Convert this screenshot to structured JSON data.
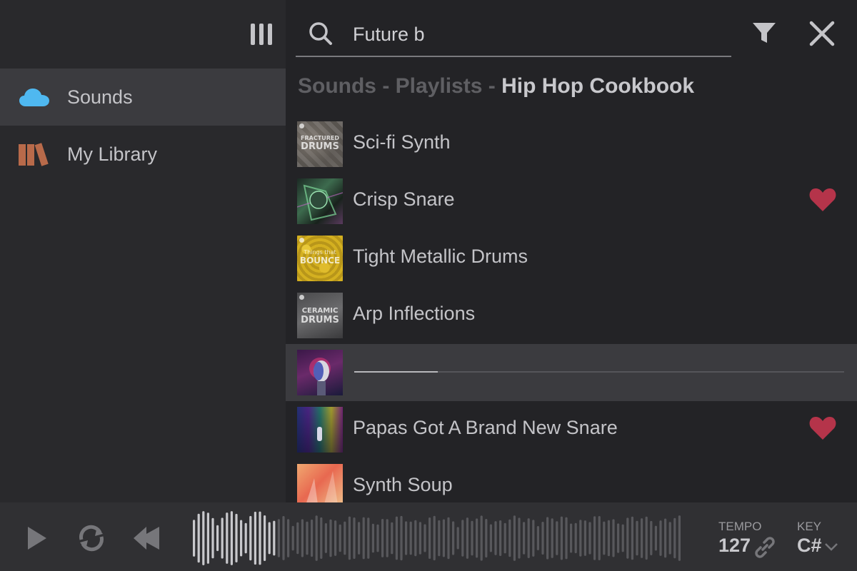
{
  "sidebar": {
    "items": [
      {
        "label": "Sounds",
        "icon": "cloud-icon",
        "active": true
      },
      {
        "label": "My Library",
        "icon": "books-icon",
        "active": false
      }
    ]
  },
  "search": {
    "value": "Future b",
    "placeholder": ""
  },
  "breadcrumb": {
    "part1": "Sounds",
    "sep1": " - ",
    "part2": "Playlists",
    "sep2": " - ",
    "current": "Hip Hop Cookbook"
  },
  "list": {
    "items": [
      {
        "title": "Sci-fi Synth",
        "thumb_line1": "FRACTURED",
        "thumb_line2": "DRUMS",
        "liked": false
      },
      {
        "title": "Crisp Snare",
        "liked": true
      },
      {
        "title": "Tight Metallic Drums",
        "thumb_line1": "Things that",
        "thumb_line2": "BOUNCE",
        "liked": false
      },
      {
        "title": "Arp Inflections",
        "thumb_line1": "CERAMIC",
        "thumb_line2": "DRUMS",
        "liked": false
      },
      {
        "title": "",
        "playing": true,
        "progress": 0.17,
        "liked": false
      },
      {
        "title": "Papas Got A Brand New Snare",
        "liked": true
      },
      {
        "title": "Synth Soup",
        "liked": false
      }
    ]
  },
  "player": {
    "tempo_label": "TEMPO",
    "tempo_value": "127",
    "key_label": "KEY",
    "key_value": "C#",
    "played_fraction": 0.17
  },
  "colors": {
    "accent_cloud": "#4fb8f0",
    "library_icon": "#b86a4a",
    "heart": "#b5344a",
    "background": "#232326"
  }
}
